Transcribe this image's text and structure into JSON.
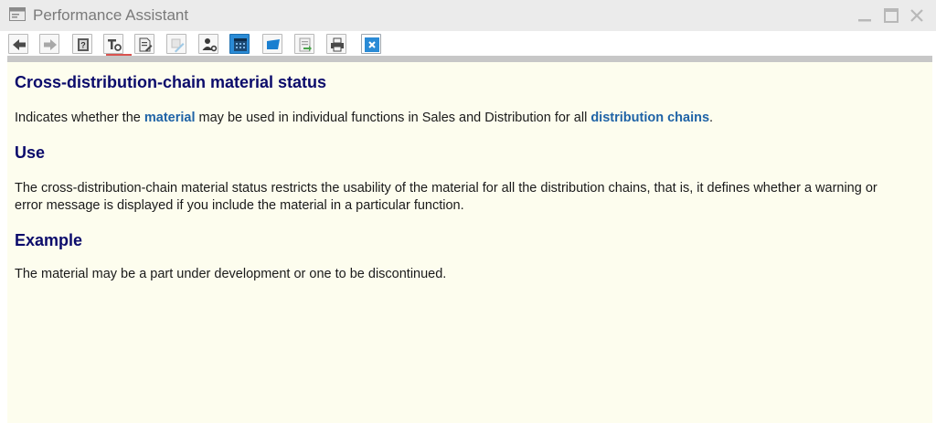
{
  "window": {
    "title": "Performance Assistant",
    "controls": [
      "minimize-icon",
      "maximize-icon",
      "close-icon"
    ]
  },
  "toolbar": {
    "buttons": [
      {
        "name": "back-button",
        "icon": "arrow-left-icon"
      },
      {
        "name": "forward-button",
        "icon": "arrow-right-icon"
      },
      {
        "name": "help-book-button",
        "icon": "book-question-icon"
      },
      {
        "name": "technical-info-button",
        "icon": "tools-icon"
      },
      {
        "name": "edit-document-button",
        "icon": "document-edit-icon"
      },
      {
        "name": "edit-disabled-button",
        "icon": "pencil-disabled-icon"
      },
      {
        "name": "user-settings-button",
        "icon": "user-wrench-icon"
      },
      {
        "name": "calendar-button",
        "icon": "calendar-icon"
      },
      {
        "name": "highlight-button",
        "icon": "marker-icon"
      },
      {
        "name": "document-transfer-button",
        "icon": "document-arrow-icon"
      },
      {
        "name": "print-button",
        "icon": "printer-icon"
      },
      {
        "name": "close-help-button",
        "icon": "close-icon"
      }
    ]
  },
  "content": {
    "heading": "Cross-distribution-chain material status",
    "definition": {
      "part1": "Indicates whether the ",
      "link1": "material",
      "part2": " may be used in individual functions in Sales and Distribution for all ",
      "link2": "distribution chains",
      "part3": "."
    },
    "use_heading": "Use",
    "use_text": "The cross-distribution-chain material status restricts the usability of the material for all the distribution chains, that is, it defines whether a warning or error message is displayed if you include the material in a particular function.",
    "example_heading": "Example",
    "example_text": "The material may be a part under development or one to be discontinued."
  },
  "colors": {
    "heading": "#0b0b6b",
    "link": "#1f63a6",
    "content_background": "#fdfdee",
    "active_button": "#2a8bd6"
  }
}
